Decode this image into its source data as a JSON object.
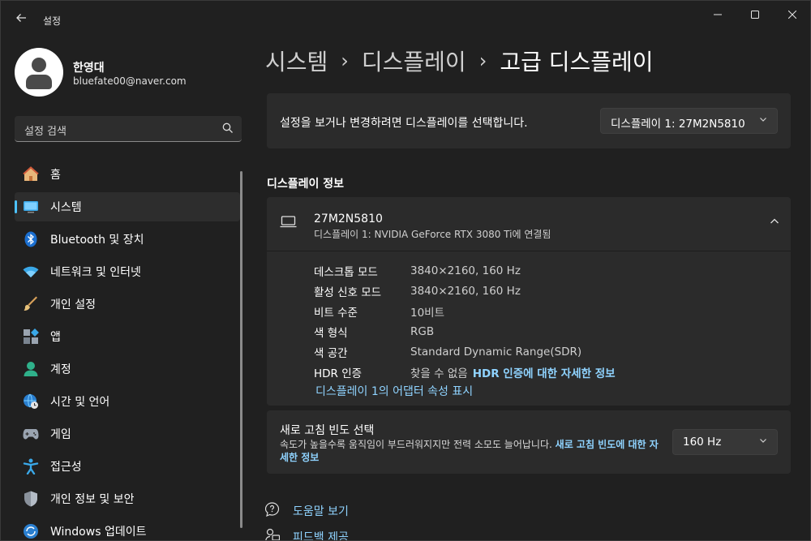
{
  "window": {
    "title": "설정",
    "back_icon": "back-arrow-icon",
    "controls": [
      "minimize-icon",
      "maximize-icon",
      "close-icon"
    ]
  },
  "profile": {
    "name": "한영대",
    "email": "bluefate00@naver.com"
  },
  "search": {
    "placeholder": "설정 검색"
  },
  "nav": {
    "items": [
      {
        "label": "홈",
        "icon": "home-icon"
      },
      {
        "label": "시스템",
        "icon": "system-icon",
        "active": true
      },
      {
        "label": "Bluetooth 및 장치",
        "icon": "bluetooth-icon"
      },
      {
        "label": "네트워크 및 인터넷",
        "icon": "wifi-icon"
      },
      {
        "label": "개인 설정",
        "icon": "brush-icon"
      },
      {
        "label": "앱",
        "icon": "apps-icon"
      },
      {
        "label": "계정",
        "icon": "account-icon"
      },
      {
        "label": "시간 및 언어",
        "icon": "time-language-icon"
      },
      {
        "label": "게임",
        "icon": "gaming-icon"
      },
      {
        "label": "접근성",
        "icon": "accessibility-icon"
      },
      {
        "label": "개인 정보 및 보안",
        "icon": "shield-icon"
      },
      {
        "label": "Windows 업데이트",
        "icon": "update-icon"
      }
    ]
  },
  "breadcrumb": {
    "items": [
      "시스템",
      "디스플레이"
    ],
    "separator": "›",
    "current": "고급 디스플레이"
  },
  "display_select": {
    "label": "설정을 보거나 변경하려면 디스플레이를 선택합니다.",
    "selected": "디스플레이 1: 27M2N5810"
  },
  "display_info": {
    "section_title": "디스플레이 정보",
    "monitor_name": "27M2N5810",
    "monitor_sub": "디스플레이 1: NVIDIA GeForce RTX 3080 Ti에 연결됨",
    "rows": [
      {
        "key": "데스크톱 모드",
        "value": "3840×2160, 160 Hz"
      },
      {
        "key": "활성 신호 모드",
        "value": "3840×2160, 160 Hz"
      },
      {
        "key": "비트 수준",
        "value": "10비트"
      },
      {
        "key": "색 형식",
        "value": "RGB"
      },
      {
        "key": "색 공간",
        "value": "Standard Dynamic Range(SDR)"
      },
      {
        "key": "HDR 인증",
        "value": "찾을 수 없음",
        "link": "HDR 인증에 대한 자세한 정보"
      }
    ],
    "adapter_link": "디스플레이 1의 어댑터 속성 표시"
  },
  "refresh": {
    "title": "새로 고침 빈도 선택",
    "desc": "속도가 높을수록 움직임이 부드러워지지만 전력 소모도 늘어납니다.",
    "link": "새로 고침 빈도에 대한 자세한 정보",
    "selected": "160 Hz"
  },
  "help": {
    "get_help": "도움말 보기",
    "feedback": "피드백 제공"
  },
  "colors": {
    "background": "#202020",
    "card": "#2b2b2b",
    "accent": "#4cc2ff",
    "link": "#8fd3ff"
  }
}
